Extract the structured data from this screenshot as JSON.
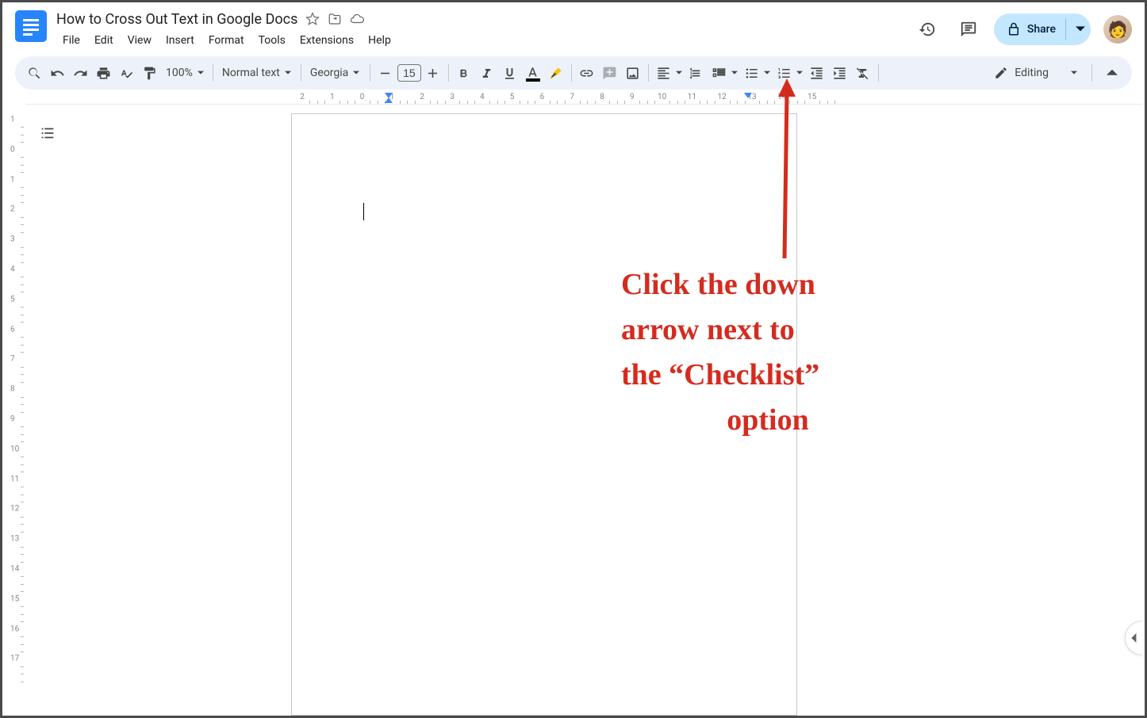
{
  "document": {
    "title": "How to Cross Out Text in Google Docs"
  },
  "menu": {
    "file": "File",
    "edit": "Edit",
    "view": "View",
    "insert": "Insert",
    "format": "Format",
    "tools": "Tools",
    "extensions": "Extensions",
    "help": "Help"
  },
  "share": {
    "label": "Share"
  },
  "toolbar": {
    "zoom": "100%",
    "style": "Normal text",
    "font": "Georgia",
    "font_size": "15",
    "mode": "Editing"
  },
  "ruler_h": {
    "start": -2,
    "end": 15,
    "first_indent_cm": 0,
    "left_indent_cm": 0,
    "right_indent_cm": 12
  },
  "ruler_v": {
    "start": -1,
    "end": 17
  },
  "annotation": {
    "line1": "Click the down",
    "line2": "arrow next to",
    "line3": "the “Checklist”",
    "line4": "option"
  }
}
